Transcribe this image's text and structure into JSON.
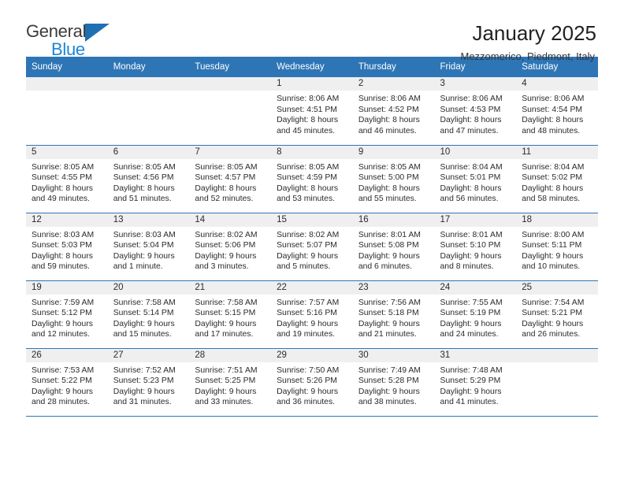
{
  "brand": {
    "name_part1": "General",
    "name_part2": "Blue",
    "accent_color": "#1b87d6",
    "triangle_color": "#1f6fb2",
    "logo_icon": "triangle-icon"
  },
  "header": {
    "title": "January 2025",
    "subtitle": "Mezzomerico, Piedmont, Italy"
  },
  "calendar": {
    "header_color": "#2e75b6",
    "daynum_band_color": "#efefef",
    "weekday_headers": [
      "Sunday",
      "Monday",
      "Tuesday",
      "Wednesday",
      "Thursday",
      "Friday",
      "Saturday"
    ],
    "weeks": [
      [
        {
          "day": "",
          "empty": true,
          "sunrise": "",
          "sunset": "",
          "daylight_line1": "",
          "daylight_line2": ""
        },
        {
          "day": "",
          "empty": true,
          "sunrise": "",
          "sunset": "",
          "daylight_line1": "",
          "daylight_line2": ""
        },
        {
          "day": "",
          "empty": true,
          "sunrise": "",
          "sunset": "",
          "daylight_line1": "",
          "daylight_line2": ""
        },
        {
          "day": "1",
          "empty": false,
          "sunrise": "Sunrise: 8:06 AM",
          "sunset": "Sunset: 4:51 PM",
          "daylight_line1": "Daylight: 8 hours",
          "daylight_line2": "and 45 minutes."
        },
        {
          "day": "2",
          "empty": false,
          "sunrise": "Sunrise: 8:06 AM",
          "sunset": "Sunset: 4:52 PM",
          "daylight_line1": "Daylight: 8 hours",
          "daylight_line2": "and 46 minutes."
        },
        {
          "day": "3",
          "empty": false,
          "sunrise": "Sunrise: 8:06 AM",
          "sunset": "Sunset: 4:53 PM",
          "daylight_line1": "Daylight: 8 hours",
          "daylight_line2": "and 47 minutes."
        },
        {
          "day": "4",
          "empty": false,
          "sunrise": "Sunrise: 8:06 AM",
          "sunset": "Sunset: 4:54 PM",
          "daylight_line1": "Daylight: 8 hours",
          "daylight_line2": "and 48 minutes."
        }
      ],
      [
        {
          "day": "5",
          "empty": false,
          "sunrise": "Sunrise: 8:05 AM",
          "sunset": "Sunset: 4:55 PM",
          "daylight_line1": "Daylight: 8 hours",
          "daylight_line2": "and 49 minutes."
        },
        {
          "day": "6",
          "empty": false,
          "sunrise": "Sunrise: 8:05 AM",
          "sunset": "Sunset: 4:56 PM",
          "daylight_line1": "Daylight: 8 hours",
          "daylight_line2": "and 51 minutes."
        },
        {
          "day": "7",
          "empty": false,
          "sunrise": "Sunrise: 8:05 AM",
          "sunset": "Sunset: 4:57 PM",
          "daylight_line1": "Daylight: 8 hours",
          "daylight_line2": "and 52 minutes."
        },
        {
          "day": "8",
          "empty": false,
          "sunrise": "Sunrise: 8:05 AM",
          "sunset": "Sunset: 4:59 PM",
          "daylight_line1": "Daylight: 8 hours",
          "daylight_line2": "and 53 minutes."
        },
        {
          "day": "9",
          "empty": false,
          "sunrise": "Sunrise: 8:05 AM",
          "sunset": "Sunset: 5:00 PM",
          "daylight_line1": "Daylight: 8 hours",
          "daylight_line2": "and 55 minutes."
        },
        {
          "day": "10",
          "empty": false,
          "sunrise": "Sunrise: 8:04 AM",
          "sunset": "Sunset: 5:01 PM",
          "daylight_line1": "Daylight: 8 hours",
          "daylight_line2": "and 56 minutes."
        },
        {
          "day": "11",
          "empty": false,
          "sunrise": "Sunrise: 8:04 AM",
          "sunset": "Sunset: 5:02 PM",
          "daylight_line1": "Daylight: 8 hours",
          "daylight_line2": "and 58 minutes."
        }
      ],
      [
        {
          "day": "12",
          "empty": false,
          "sunrise": "Sunrise: 8:03 AM",
          "sunset": "Sunset: 5:03 PM",
          "daylight_line1": "Daylight: 8 hours",
          "daylight_line2": "and 59 minutes."
        },
        {
          "day": "13",
          "empty": false,
          "sunrise": "Sunrise: 8:03 AM",
          "sunset": "Sunset: 5:04 PM",
          "daylight_line1": "Daylight: 9 hours",
          "daylight_line2": "and 1 minute."
        },
        {
          "day": "14",
          "empty": false,
          "sunrise": "Sunrise: 8:02 AM",
          "sunset": "Sunset: 5:06 PM",
          "daylight_line1": "Daylight: 9 hours",
          "daylight_line2": "and 3 minutes."
        },
        {
          "day": "15",
          "empty": false,
          "sunrise": "Sunrise: 8:02 AM",
          "sunset": "Sunset: 5:07 PM",
          "daylight_line1": "Daylight: 9 hours",
          "daylight_line2": "and 5 minutes."
        },
        {
          "day": "16",
          "empty": false,
          "sunrise": "Sunrise: 8:01 AM",
          "sunset": "Sunset: 5:08 PM",
          "daylight_line1": "Daylight: 9 hours",
          "daylight_line2": "and 6 minutes."
        },
        {
          "day": "17",
          "empty": false,
          "sunrise": "Sunrise: 8:01 AM",
          "sunset": "Sunset: 5:10 PM",
          "daylight_line1": "Daylight: 9 hours",
          "daylight_line2": "and 8 minutes."
        },
        {
          "day": "18",
          "empty": false,
          "sunrise": "Sunrise: 8:00 AM",
          "sunset": "Sunset: 5:11 PM",
          "daylight_line1": "Daylight: 9 hours",
          "daylight_line2": "and 10 minutes."
        }
      ],
      [
        {
          "day": "19",
          "empty": false,
          "sunrise": "Sunrise: 7:59 AM",
          "sunset": "Sunset: 5:12 PM",
          "daylight_line1": "Daylight: 9 hours",
          "daylight_line2": "and 12 minutes."
        },
        {
          "day": "20",
          "empty": false,
          "sunrise": "Sunrise: 7:58 AM",
          "sunset": "Sunset: 5:14 PM",
          "daylight_line1": "Daylight: 9 hours",
          "daylight_line2": "and 15 minutes."
        },
        {
          "day": "21",
          "empty": false,
          "sunrise": "Sunrise: 7:58 AM",
          "sunset": "Sunset: 5:15 PM",
          "daylight_line1": "Daylight: 9 hours",
          "daylight_line2": "and 17 minutes."
        },
        {
          "day": "22",
          "empty": false,
          "sunrise": "Sunrise: 7:57 AM",
          "sunset": "Sunset: 5:16 PM",
          "daylight_line1": "Daylight: 9 hours",
          "daylight_line2": "and 19 minutes."
        },
        {
          "day": "23",
          "empty": false,
          "sunrise": "Sunrise: 7:56 AM",
          "sunset": "Sunset: 5:18 PM",
          "daylight_line1": "Daylight: 9 hours",
          "daylight_line2": "and 21 minutes."
        },
        {
          "day": "24",
          "empty": false,
          "sunrise": "Sunrise: 7:55 AM",
          "sunset": "Sunset: 5:19 PM",
          "daylight_line1": "Daylight: 9 hours",
          "daylight_line2": "and 24 minutes."
        },
        {
          "day": "25",
          "empty": false,
          "sunrise": "Sunrise: 7:54 AM",
          "sunset": "Sunset: 5:21 PM",
          "daylight_line1": "Daylight: 9 hours",
          "daylight_line2": "and 26 minutes."
        }
      ],
      [
        {
          "day": "26",
          "empty": false,
          "sunrise": "Sunrise: 7:53 AM",
          "sunset": "Sunset: 5:22 PM",
          "daylight_line1": "Daylight: 9 hours",
          "daylight_line2": "and 28 minutes."
        },
        {
          "day": "27",
          "empty": false,
          "sunrise": "Sunrise: 7:52 AM",
          "sunset": "Sunset: 5:23 PM",
          "daylight_line1": "Daylight: 9 hours",
          "daylight_line2": "and 31 minutes."
        },
        {
          "day": "28",
          "empty": false,
          "sunrise": "Sunrise: 7:51 AM",
          "sunset": "Sunset: 5:25 PM",
          "daylight_line1": "Daylight: 9 hours",
          "daylight_line2": "and 33 minutes."
        },
        {
          "day": "29",
          "empty": false,
          "sunrise": "Sunrise: 7:50 AM",
          "sunset": "Sunset: 5:26 PM",
          "daylight_line1": "Daylight: 9 hours",
          "daylight_line2": "and 36 minutes."
        },
        {
          "day": "30",
          "empty": false,
          "sunrise": "Sunrise: 7:49 AM",
          "sunset": "Sunset: 5:28 PM",
          "daylight_line1": "Daylight: 9 hours",
          "daylight_line2": "and 38 minutes."
        },
        {
          "day": "31",
          "empty": false,
          "sunrise": "Sunrise: 7:48 AM",
          "sunset": "Sunset: 5:29 PM",
          "daylight_line1": "Daylight: 9 hours",
          "daylight_line2": "and 41 minutes."
        },
        {
          "day": "",
          "empty": true,
          "sunrise": "",
          "sunset": "",
          "daylight_line1": "",
          "daylight_line2": ""
        }
      ]
    ]
  }
}
